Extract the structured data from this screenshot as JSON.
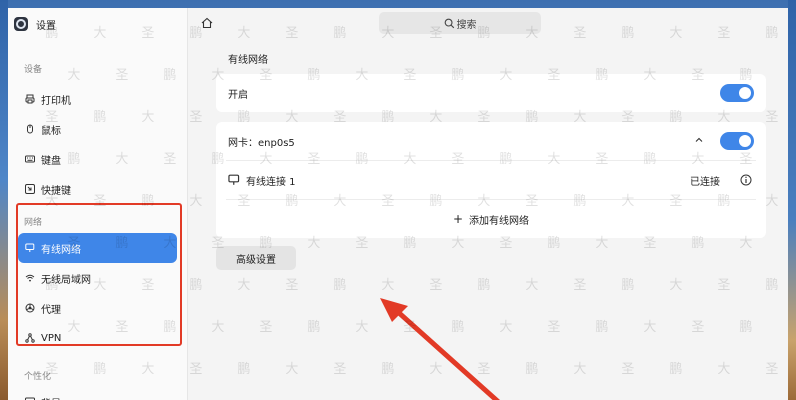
{
  "app": {
    "title": "设置"
  },
  "sidebar": {
    "groups": [
      {
        "title": "设备",
        "items": [
          {
            "label": "打印机",
            "icon": "printer-icon"
          },
          {
            "label": "鼠标",
            "icon": "mouse-icon"
          },
          {
            "label": "键盘",
            "icon": "keyboard-icon"
          },
          {
            "label": "快捷键",
            "icon": "shortcut-icon"
          }
        ]
      },
      {
        "title": "网络",
        "items": [
          {
            "label": "有线网络",
            "icon": "wired-network-icon",
            "active": true
          },
          {
            "label": "无线局域网",
            "icon": "wifi-icon"
          },
          {
            "label": "代理",
            "icon": "proxy-icon"
          },
          {
            "label": "VPN",
            "icon": "vpn-icon"
          }
        ]
      },
      {
        "title": "个性化",
        "items": [
          {
            "label": "背景",
            "icon": "background-icon"
          }
        ]
      }
    ]
  },
  "topbar": {
    "search_placeholder": "搜索"
  },
  "main": {
    "section_title": "有线网络",
    "enable_label": "开启",
    "enable_on": true,
    "nic": {
      "label": "网卡：enp0s5",
      "on": true,
      "connections": [
        {
          "name": "有线连接 1",
          "status": "已连接"
        }
      ],
      "add_label": "添加有线网络"
    },
    "advanced_button": "高级设置"
  },
  "colors": {
    "accent": "#3f86e8",
    "highlight": "#e23a26"
  },
  "watermark": [
    "鹏",
    "大",
    "圣"
  ]
}
